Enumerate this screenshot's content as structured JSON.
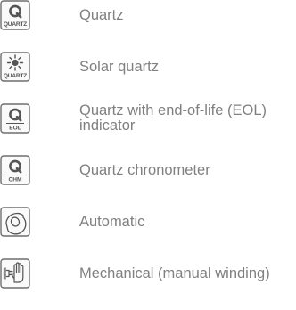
{
  "items": [
    {
      "icon": "quartz-icon",
      "icon_text": "QUARTZ",
      "label": "Quartz"
    },
    {
      "icon": "solar-quartz-icon",
      "icon_text": "QUARTZ",
      "label": "Solar quartz"
    },
    {
      "icon": "quartz-eol-icon",
      "icon_text": "EOL",
      "label_line1": "Quartz with end-of-life (EOL)",
      "label_line2": "indicator"
    },
    {
      "icon": "quartz-chronometer-icon",
      "icon_text": "CHM",
      "label": "Quartz chronometer"
    },
    {
      "icon": "automatic-icon",
      "label": "Automatic"
    },
    {
      "icon": "mechanical-manual-winding-icon",
      "label": "Mechanical (manual winding)"
    }
  ],
  "colors": {
    "icon_stroke": "#6e6e6e",
    "text": "#808080"
  }
}
